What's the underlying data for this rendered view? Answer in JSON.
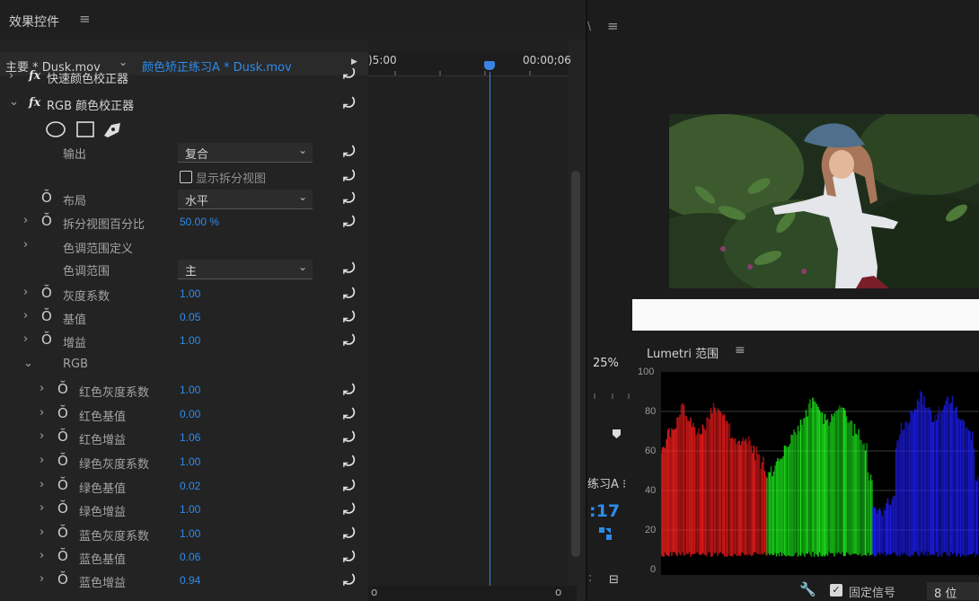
{
  "effects_panel": {
    "title": "效果控件",
    "menu_icon": "≡",
    "tab_master": "主要 * Dusk.mov",
    "tab_chevron": "⌄",
    "tab_clip": "颜色矫正练习A * Dusk.mov",
    "tab_play_icon": "▶",
    "timecode_start": ")5:00",
    "timecode_end": "00:00;06",
    "effect_fast_color": "快速颜色校正器",
    "fx_symbol": "fx",
    "effect_rgb": "RGB 颜色校正器",
    "output_label": "输出",
    "output_value": "复合",
    "split_view_label": "显示拆分视图",
    "layout_label": "布局",
    "layout_value": "水平",
    "split_percent_label": "拆分视图百分比",
    "split_percent_value": "50.00 %",
    "tonal_def_label": "色调范围定义",
    "tonal_range_label": "色调范围",
    "tonal_range_value": "主",
    "gamma_label": "灰度系数",
    "gamma_value": "1.00",
    "pedestal_label": "基值",
    "pedestal_value": "0.05",
    "gain_label": "增益",
    "gain_value": "1.00",
    "rgb_group_label": "RGB",
    "rgb_params": [
      {
        "label": "红色灰度系数",
        "value": "1.00"
      },
      {
        "label": "红色基值",
        "value": "0.00"
      },
      {
        "label": "红色增益",
        "value": "1.06"
      },
      {
        "label": "绿色灰度系数",
        "value": "1.00"
      },
      {
        "label": "绿色基值",
        "value": "0.02"
      },
      {
        "label": "绿色增益",
        "value": "1.00"
      },
      {
        "label": "蓝色灰度系数",
        "value": "1.00"
      },
      {
        "label": "蓝色基值",
        "value": "0.06"
      },
      {
        "label": "蓝色增益",
        "value": "0.94"
      }
    ],
    "reset_icon": "⤾",
    "stopwatch_icon": "Ŏ",
    "expand_icon": "›",
    "collapse_icon": "⌄",
    "dropdown_chevron": "⌄",
    "scroll_circle_icon": "o"
  },
  "monitor": {
    "menu_icon": "≡",
    "edge_text": "\\",
    "zoom": "25%",
    "sequence_fragment": "练习A ⁝",
    "timecode_fragment": ":17",
    "bottom_icon": "⊟",
    "bottom_sep": ":"
  },
  "scopes": {
    "title": "Lumetri 范围",
    "menu_icon": "≡",
    "ticks": [
      "100",
      "80",
      "60",
      "40",
      "20",
      "0"
    ],
    "fixed_signal_label": "固定信号",
    "bit_depth": "8 位",
    "wrench_icon": "🔧",
    "check_mark": "✓",
    "bit_chevron": "⌄",
    "colors": {
      "red": "#ff1e1e",
      "green": "#1eff1e",
      "blue": "#1e1eff"
    }
  }
}
